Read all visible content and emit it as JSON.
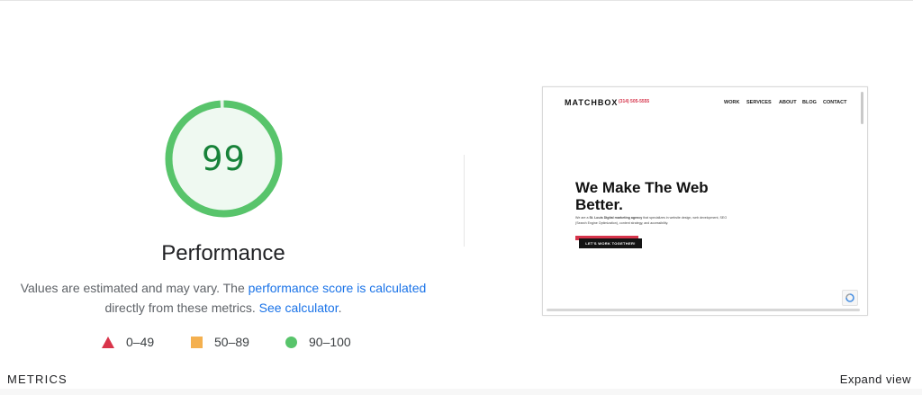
{
  "score": {
    "value": "99",
    "fraction": 0.99,
    "title": "Performance",
    "ring_color": "#58c46b",
    "fill_color": "#eff9f1",
    "text_color": "#178239"
  },
  "description": {
    "text_before": "Values are estimated and may vary. The ",
    "link1": "performance score is calculated",
    "text_middle": " directly from these metrics. ",
    "link2": "See calculator",
    "text_after": "."
  },
  "legend": [
    {
      "label": "0–49",
      "shape": "triangle",
      "color": "#d9344a"
    },
    {
      "label": "50–89",
      "shape": "square",
      "color": "#f4b04f"
    },
    {
      "label": "90–100",
      "shape": "circle",
      "color": "#58c46b"
    }
  ],
  "preview": {
    "logo": "MATCHBOX",
    "phone": "(314) 505-5555",
    "nav": [
      "WORK",
      "SERVICES",
      "ABOUT",
      "BLOG",
      "CONTACT"
    ],
    "headline": "We Make The Web Better.",
    "body_before": "We are a ",
    "body_bold": "St. Louis Digital marketing agency",
    "body_after": " that specializes in website design, web development, SEO (Search Engine Optimization), content strategy, and accessibility.",
    "cta": "LET'S WORK TOGETHER!"
  },
  "footer": {
    "metrics_heading": "METRICS",
    "expand_view": "Expand view"
  }
}
